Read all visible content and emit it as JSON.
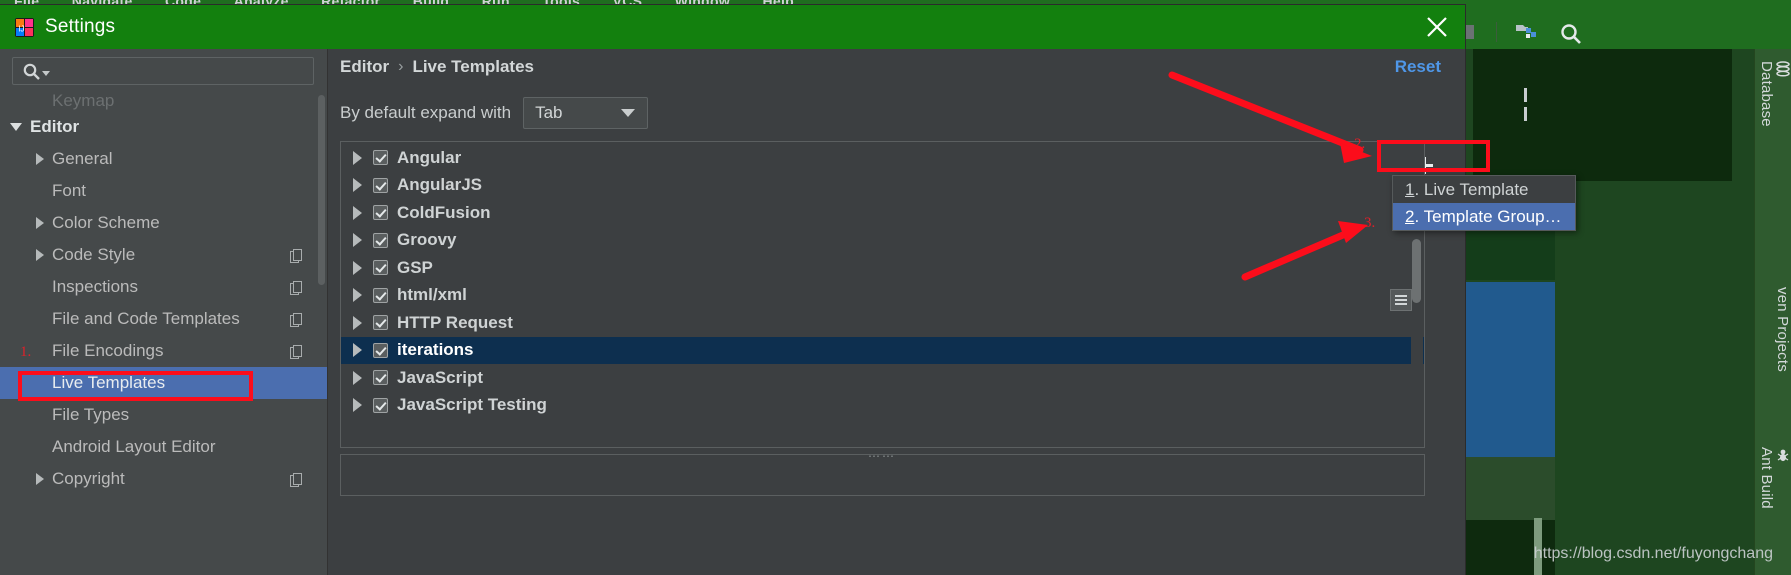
{
  "ide": {
    "menubar": [
      "File",
      "Navigate",
      "Code",
      "Analyze",
      "Refactor",
      "Build",
      "Run",
      "Tools",
      "VCS",
      "Window",
      "Help"
    ],
    "toolbar_icons": [
      "stop-icon",
      "project-structure-icon",
      "search-everywhere-icon"
    ],
    "tool_windows": [
      {
        "label": "Database",
        "icon": "database-icon"
      },
      {
        "label": "ven Projects",
        "icon": "maven-icon"
      },
      {
        "label": "Ant Build",
        "icon": "ant-icon"
      }
    ],
    "accent_green": "#1f6d1f"
  },
  "dialog": {
    "title": "Settings",
    "logo_icon": "intellij-idea-icon",
    "close_icon": "close-icon",
    "titlebar_color": "#13800e"
  },
  "search": {
    "placeholder": "",
    "value": "",
    "icon": "search-icon",
    "dropdown_icon": "chevron-down-icon"
  },
  "sidebar": {
    "items": [
      {
        "label": "Keymap",
        "twisty": "none",
        "indent": 1,
        "clipped": true,
        "bold": false,
        "selected": false,
        "badge": false
      },
      {
        "label": "Editor",
        "twisty": "down",
        "indent": 0,
        "clipped": false,
        "bold": true,
        "selected": false,
        "badge": false
      },
      {
        "label": "General",
        "twisty": "right",
        "indent": 1,
        "clipped": false,
        "bold": false,
        "selected": false,
        "badge": false
      },
      {
        "label": "Font",
        "twisty": "none",
        "indent": 1,
        "clipped": false,
        "bold": false,
        "selected": false,
        "badge": false
      },
      {
        "label": "Color Scheme",
        "twisty": "right",
        "indent": 1,
        "clipped": false,
        "bold": false,
        "selected": false,
        "badge": false
      },
      {
        "label": "Code Style",
        "twisty": "right",
        "indent": 1,
        "clipped": false,
        "bold": false,
        "selected": false,
        "badge": true
      },
      {
        "label": "Inspections",
        "twisty": "none",
        "indent": 1,
        "clipped": false,
        "bold": false,
        "selected": false,
        "badge": true
      },
      {
        "label": "File and Code Templates",
        "twisty": "none",
        "indent": 1,
        "clipped": false,
        "bold": false,
        "selected": false,
        "badge": true
      },
      {
        "label": "File Encodings",
        "twisty": "none",
        "indent": 1,
        "clipped": false,
        "bold": false,
        "selected": false,
        "badge": true
      },
      {
        "label": "Live Templates",
        "twisty": "none",
        "indent": 1,
        "clipped": false,
        "bold": false,
        "selected": true,
        "badge": false
      },
      {
        "label": "File Types",
        "twisty": "none",
        "indent": 1,
        "clipped": false,
        "bold": false,
        "selected": false,
        "badge": false
      },
      {
        "label": "Android Layout Editor",
        "twisty": "none",
        "indent": 1,
        "clipped": false,
        "bold": false,
        "selected": false,
        "badge": false
      },
      {
        "label": "Copyright",
        "twisty": "right",
        "indent": 1,
        "clipped": false,
        "bold": false,
        "selected": false,
        "badge": true
      }
    ],
    "selected_color": "#4b6eaf"
  },
  "main": {
    "breadcrumb": {
      "root": "Editor",
      "separator": "›",
      "leaf": "Live Templates"
    },
    "reset_label": "Reset",
    "reset_color": "#4f97e8",
    "expand_label": "By default expand with",
    "expand_value": "Tab",
    "expand_arrow_icon": "chevron-down-icon",
    "add_button_icon": "plus-icon",
    "list_settings_icon": "list-options-icon",
    "drag_handle": "⋯⋯",
    "templates": [
      {
        "name": "Angular",
        "checked": true,
        "selected": false
      },
      {
        "name": "AngularJS",
        "checked": true,
        "selected": false
      },
      {
        "name": "ColdFusion",
        "checked": true,
        "selected": false
      },
      {
        "name": "Groovy",
        "checked": true,
        "selected": false
      },
      {
        "name": "GSP",
        "checked": true,
        "selected": false
      },
      {
        "name": "html/xml",
        "checked": true,
        "selected": false
      },
      {
        "name": "HTTP Request",
        "checked": true,
        "selected": false
      },
      {
        "name": "iterations",
        "checked": true,
        "selected": true
      },
      {
        "name": "JavaScript",
        "checked": true,
        "selected": false
      },
      {
        "name": "JavaScript Testing",
        "checked": true,
        "selected": false
      }
    ],
    "selected_row_color": "#0d2f4f"
  },
  "menu": {
    "items": [
      {
        "mnemonic": "1",
        "label": ". Live Template",
        "active": false
      },
      {
        "mnemonic": "2",
        "label": ". Template Group…",
        "active": true
      }
    ],
    "active_color": "#4b6eaf"
  },
  "annotations": {
    "color": "#fc0d1b",
    "markers": [
      {
        "num": "1.",
        "target": "live-templates-sidebar-item"
      },
      {
        "num": "2.",
        "target": "add-template-button"
      },
      {
        "num": "3.",
        "target": "template-group-menu-item"
      }
    ]
  },
  "watermark": "https://blog.csdn.net/fuyongchang"
}
